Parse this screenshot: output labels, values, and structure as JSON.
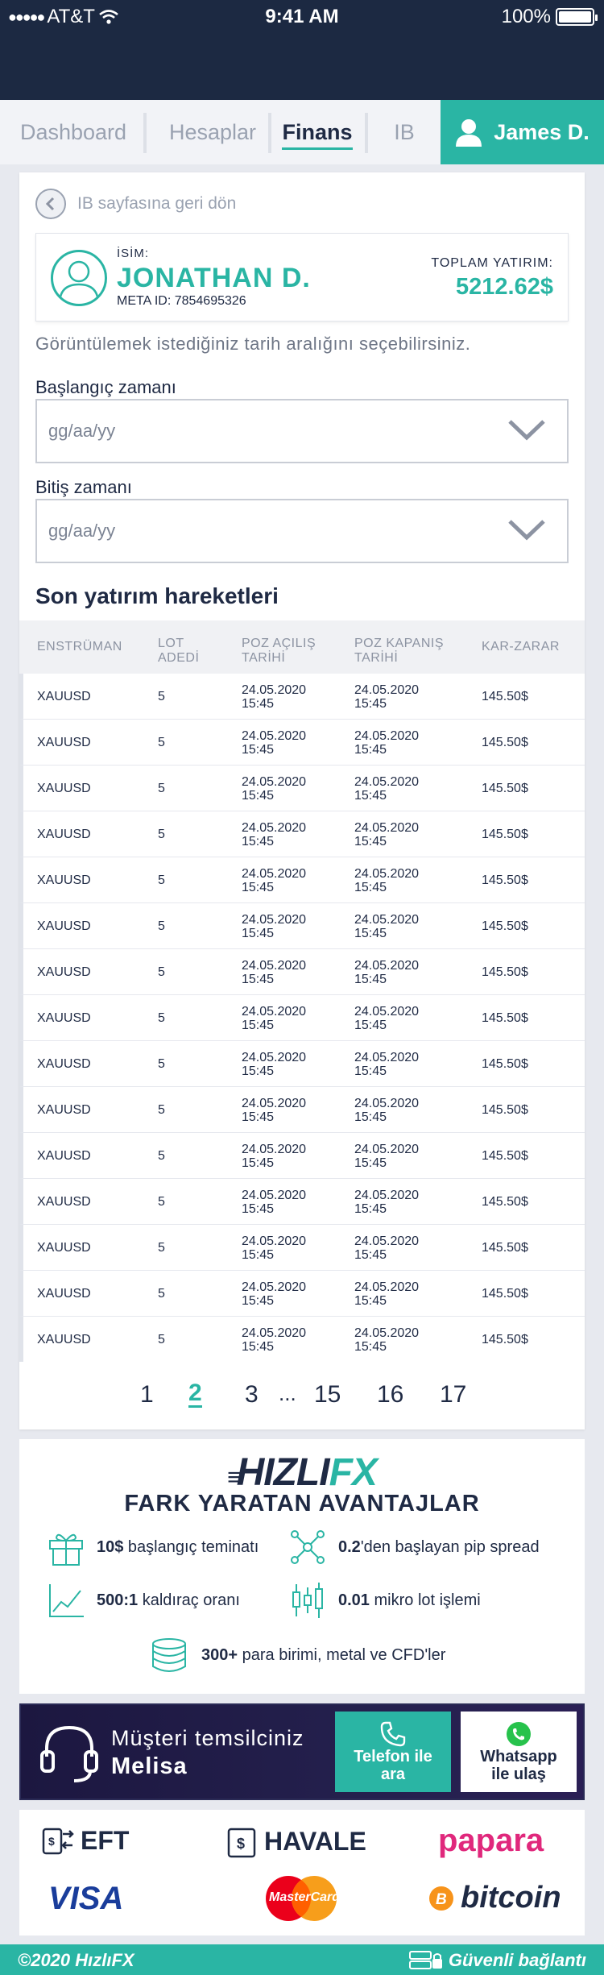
{
  "status_bar": {
    "carrier": "AT&T",
    "time": "9:41 AM",
    "battery": "100%"
  },
  "tabs": [
    {
      "label": "Dashboard"
    },
    {
      "label": "Hesaplar"
    },
    {
      "label": "Finans"
    },
    {
      "label": "IB"
    }
  ],
  "user": {
    "name": "James D."
  },
  "back_link": "IB sayfasına geri dön",
  "investor": {
    "name_label": "İSİM:",
    "name": "JONATHAN D.",
    "meta_id": "META ID: 7854695326",
    "total_label": "TOPLAM YATIRIM:",
    "total_value": "5212.62$"
  },
  "date_hint": "Görüntülemek istediğiniz tarih aralığını seçebilirsiniz.",
  "start_date": {
    "label": "Başlangıç zamanı",
    "placeholder": "gg/aa/yy"
  },
  "end_date": {
    "label": "Bitiş zamanı",
    "placeholder": "gg/aa/yy"
  },
  "table": {
    "title": "Son yatırım hareketleri",
    "headers": {
      "instrument": "ENSTRÜMAN",
      "lot_1": "LOT",
      "lot_2": "ADEDİ",
      "open_1": "POZ AÇILIŞ",
      "open_2": "TARİHİ",
      "close_1": "POZ KAPANIŞ",
      "close_2": "TARİHİ",
      "pnl": "KAR-ZARAR"
    },
    "rows": [
      {
        "instrument": "XAUUSD",
        "lot": "5",
        "open_date": "24.05.2020",
        "open_time": "15:45",
        "close_date": "24.05.2020",
        "close_time": "15:45",
        "pnl": "145.50$"
      },
      {
        "instrument": "XAUUSD",
        "lot": "5",
        "open_date": "24.05.2020",
        "open_time": "15:45",
        "close_date": "24.05.2020",
        "close_time": "15:45",
        "pnl": "145.50$"
      },
      {
        "instrument": "XAUUSD",
        "lot": "5",
        "open_date": "24.05.2020",
        "open_time": "15:45",
        "close_date": "24.05.2020",
        "close_time": "15:45",
        "pnl": "145.50$"
      },
      {
        "instrument": "XAUUSD",
        "lot": "5",
        "open_date": "24.05.2020",
        "open_time": "15:45",
        "close_date": "24.05.2020",
        "close_time": "15:45",
        "pnl": "145.50$"
      },
      {
        "instrument": "XAUUSD",
        "lot": "5",
        "open_date": "24.05.2020",
        "open_time": "15:45",
        "close_date": "24.05.2020",
        "close_time": "15:45",
        "pnl": "145.50$"
      },
      {
        "instrument": "XAUUSD",
        "lot": "5",
        "open_date": "24.05.2020",
        "open_time": "15:45",
        "close_date": "24.05.2020",
        "close_time": "15:45",
        "pnl": "145.50$"
      },
      {
        "instrument": "XAUUSD",
        "lot": "5",
        "open_date": "24.05.2020",
        "open_time": "15:45",
        "close_date": "24.05.2020",
        "close_time": "15:45",
        "pnl": "145.50$"
      },
      {
        "instrument": "XAUUSD",
        "lot": "5",
        "open_date": "24.05.2020",
        "open_time": "15:45",
        "close_date": "24.05.2020",
        "close_time": "15:45",
        "pnl": "145.50$"
      },
      {
        "instrument": "XAUUSD",
        "lot": "5",
        "open_date": "24.05.2020",
        "open_time": "15:45",
        "close_date": "24.05.2020",
        "close_time": "15:45",
        "pnl": "145.50$"
      },
      {
        "instrument": "XAUUSD",
        "lot": "5",
        "open_date": "24.05.2020",
        "open_time": "15:45",
        "close_date": "24.05.2020",
        "close_time": "15:45",
        "pnl": "145.50$"
      },
      {
        "instrument": "XAUUSD",
        "lot": "5",
        "open_date": "24.05.2020",
        "open_time": "15:45",
        "close_date": "24.05.2020",
        "close_time": "15:45",
        "pnl": "145.50$"
      },
      {
        "instrument": "XAUUSD",
        "lot": "5",
        "open_date": "24.05.2020",
        "open_time": "15:45",
        "close_date": "24.05.2020",
        "close_time": "15:45",
        "pnl": "145.50$"
      },
      {
        "instrument": "XAUUSD",
        "lot": "5",
        "open_date": "24.05.2020",
        "open_time": "15:45",
        "close_date": "24.05.2020",
        "close_time": "15:45",
        "pnl": "145.50$"
      },
      {
        "instrument": "XAUUSD",
        "lot": "5",
        "open_date": "24.05.2020",
        "open_time": "15:45",
        "close_date": "24.05.2020",
        "close_time": "15:45",
        "pnl": "145.50$"
      },
      {
        "instrument": "XAUUSD",
        "lot": "5",
        "open_date": "24.05.2020",
        "open_time": "15:45",
        "close_date": "24.05.2020",
        "close_time": "15:45",
        "pnl": "145.50$"
      }
    ]
  },
  "pagination": {
    "pages": [
      "1",
      "2",
      "3",
      "...",
      "15",
      "16",
      "17"
    ],
    "current": "2"
  },
  "advantages": {
    "logo_main": "HIZLI",
    "logo_accent": "FX",
    "title": "FARK YARATAN AVANTAJLAR",
    "items": [
      {
        "icon": "gift-icon",
        "bold": "10$",
        "text": " başlangıç teminatı"
      },
      {
        "icon": "network-icon",
        "bold": "0.2",
        "text": "'den başlayan pip spread"
      },
      {
        "icon": "chart-line-icon",
        "bold": "500:1",
        "text": " kaldıraç oranı"
      },
      {
        "icon": "candlestick-icon",
        "bold": "0.01",
        "text": " mikro lot işlemi"
      },
      {
        "icon": "coins-icon",
        "bold": "300+",
        "text": " para birimi, metal ve CFD'ler"
      }
    ]
  },
  "contact": {
    "label": "Müşteri temsilciniz",
    "name": "Melisa",
    "phone_button_1": "Telefon ile",
    "phone_button_2": "ara",
    "whatsapp_button_1": "Whatsapp",
    "whatsapp_button_2": "ile ulaş"
  },
  "payments": {
    "eft": "EFT",
    "havale": "HAVALE",
    "papara": "papara",
    "visa": "VISA",
    "mastercard": "MasterCard",
    "bitcoin": "bitcoin"
  },
  "footer": {
    "copyright": "©2020 HızlıFX",
    "secure": "Güvenli bağlantı"
  },
  "colors": {
    "accent": "#2ab5a4",
    "navy": "#1c2942",
    "text": "#1f2a44"
  }
}
